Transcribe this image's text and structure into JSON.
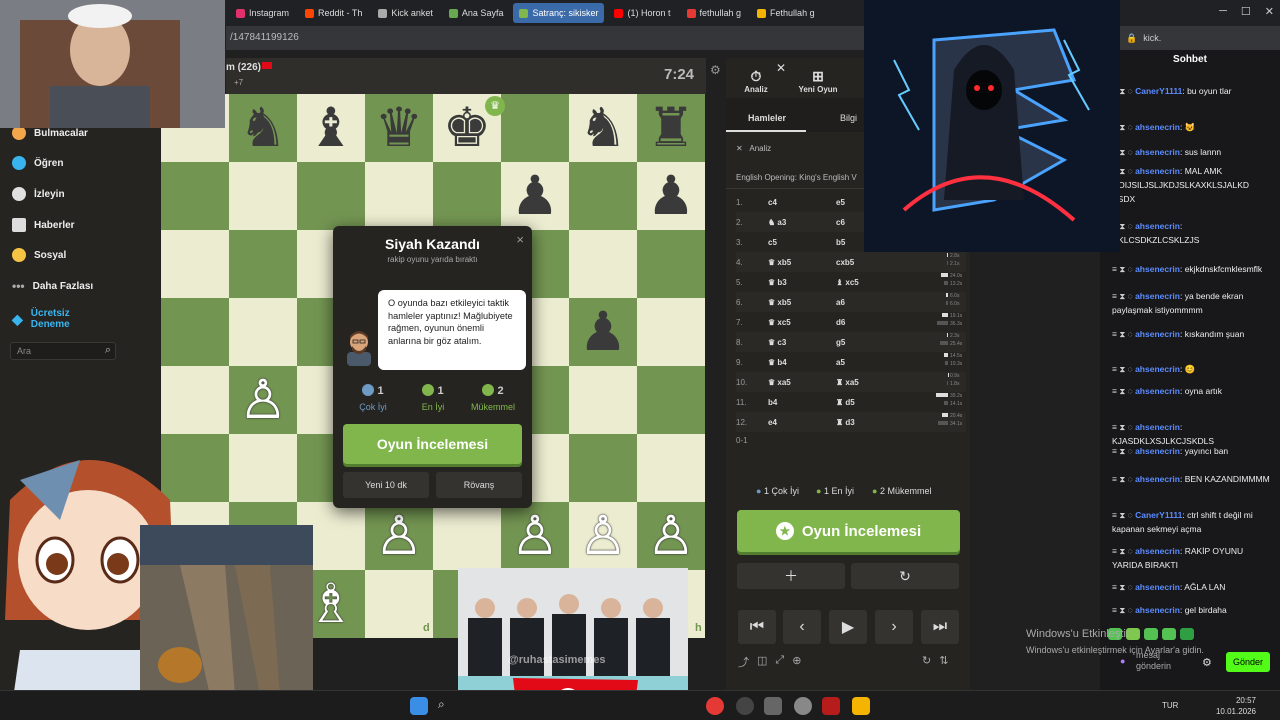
{
  "browser_tabs": [
    {
      "label": "Instagram",
      "color": "#e1306c"
    },
    {
      "label": "Reddit - Th",
      "color": "#ff4500"
    },
    {
      "label": "Kick anket",
      "color": "#aaaaaa"
    },
    {
      "label": "Ana Sayfa",
      "color": "#6aa84f"
    },
    {
      "label": "Satranç: sikisker",
      "color": "#81b64c"
    },
    {
      "label": "(1) Horon t",
      "color": "#ff0000"
    },
    {
      "label": "fethullah g",
      "color": "#e53935"
    },
    {
      "label": "Fethullah g",
      "color": "#f4b400"
    }
  ],
  "address": {
    "url": "/147841199126",
    "right": "kick."
  },
  "sidebar": {
    "items": [
      "Bulmacalar",
      "Öğren",
      "İzleyin",
      "Haberler",
      "Sosyal",
      "Daha Fazlası",
      "Ücretsiz Deneme"
    ],
    "search_placeholder": "Ara"
  },
  "player": {
    "name": "m (226)",
    "rating_change": "+7",
    "timer": "7:24"
  },
  "board": {
    "ranks": [
      "7",
      "6",
      "5",
      "4",
      "3",
      "2"
    ],
    "files": [
      "c",
      "d",
      "h"
    ],
    "pieces": [
      {
        "sq": "a8",
        "p": "♞",
        "c": "b"
      },
      {
        "sq": "b8",
        "p": "♝",
        "c": "b"
      },
      {
        "sq": "c8",
        "p": "♛",
        "c": "b"
      },
      {
        "sq": "d8",
        "p": "♚",
        "c": "b"
      },
      {
        "sq": "f8",
        "p": "♞",
        "c": "b"
      },
      {
        "sq": "g8",
        "p": "♜",
        "c": "b"
      },
      {
        "sq": "e7",
        "p": "♟",
        "c": "b"
      },
      {
        "sq": "g7",
        "p": "♟",
        "c": "b"
      },
      {
        "sq": "f5",
        "p": "♟",
        "c": "b"
      },
      {
        "sq": "a4",
        "p": "♙",
        "c": "w"
      },
      {
        "sq": "c2",
        "p": "♙",
        "c": "w"
      },
      {
        "sq": "e2",
        "p": "♙",
        "c": "w"
      },
      {
        "sq": "f2",
        "p": "♙",
        "c": "w"
      },
      {
        "sq": "g2",
        "p": "♙",
        "c": "w"
      },
      {
        "sq": "b1",
        "p": "♗",
        "c": "w"
      }
    ]
  },
  "modal": {
    "title": "Siyah Kazandı",
    "subtitle": "rakip oyunu yarıda bıraktı",
    "coach_text": "O oyunda bazı etkileyici taktik hamleler yaptınız! Mağlubiyete rağmen, oyunun önemli anlarına bir göz atalım.",
    "stats": [
      {
        "n": "1",
        "label": "Çok İyi",
        "color": "#6d9bc3"
      },
      {
        "n": "1",
        "label": "En İyi",
        "color": "#81b64c"
      },
      {
        "n": "2",
        "label": "Mükemmel",
        "color": "#81b64c"
      }
    ],
    "review_button": "Oyun İncelemesi",
    "new_game": "Yeni 10 dk",
    "rematch": "Rövanş",
    "close": "×"
  },
  "analysis": {
    "tabs": [
      "Analiz",
      "Yeni Oyun"
    ],
    "subtabs": [
      "Hamleler",
      "Bilgi"
    ],
    "analysis_label": "Analiz",
    "opening": "English Opening: King's English V",
    "moves": [
      {
        "n": "1.",
        "w": "c4",
        "b": "e5",
        "t1": "",
        "t2": ""
      },
      {
        "n": "2.",
        "w": "♞ a3",
        "b": "c6",
        "t1": "",
        "t2": ""
      },
      {
        "n": "3.",
        "w": "c5",
        "b": "b5",
        "t1": "",
        "t2": ""
      },
      {
        "n": "4.",
        "w": "♛ xb5",
        "b": "cxb5",
        "t1": "2.8s",
        "t2": "2.1s"
      },
      {
        "n": "5.",
        "w": "♛ b3",
        "b": "♝ xc5",
        "t1": "24.0s",
        "t2": "13.2s"
      },
      {
        "n": "6.",
        "w": "♛ xb5",
        "b": "a6",
        "t1": "6.0s",
        "t2": "6.0s"
      },
      {
        "n": "7.",
        "w": "♛ xc5",
        "b": "d6",
        "t1": "19.1s",
        "t2": "36.3s"
      },
      {
        "n": "8.",
        "w": "♛ c3",
        "b": "g5",
        "t1": "2.3s",
        "t2": "25.4s"
      },
      {
        "n": "9.",
        "w": "♛ b4",
        "b": "a5",
        "t1": "14.5s",
        "t2": "10.3s"
      },
      {
        "n": "10.",
        "w": "♛ xa5",
        "b": "♜ xa5",
        "t1": "0.9s",
        "t2": "1.8s"
      },
      {
        "n": "11.",
        "w": "b4",
        "b": "♜ d5",
        "t1": "39.2s",
        "t2": "14.1s"
      },
      {
        "n": "12.",
        "w": "e4",
        "b": "♜ d3",
        "t1": "20.4s",
        "t2": "34.1s"
      }
    ],
    "result": "0-1",
    "summary": [
      "1 Çok İyi",
      "1 En İyi",
      "2 Mükemmel"
    ],
    "review_button": "Oyun İncelemesi"
  },
  "chat": {
    "title": "Sohbet",
    "messages": [
      {
        "user": "CanerY1111",
        "ucolor": "#5b8cff",
        "text": ": bu oyun tlar"
      },
      {
        "user": "ahsenecrin",
        "ucolor": "#5b8cff",
        "text": ": 😺"
      },
      {
        "user": "ahsenecrin",
        "ucolor": "#5b8cff",
        "text": ": sus lannn"
      },
      {
        "user": "ahsenecrin",
        "ucolor": "#5b8cff",
        "text": ": MAL AMK DOIJSILJSLJKDJSLKAXKLSJALKD ASDX"
      },
      {
        "user": "ahsenecrin",
        "ucolor": "#5b8cff",
        "text": ": DKLCSDKZLCSKLZJS"
      },
      {
        "user": "ahsenecrin",
        "ucolor": "#5b8cff",
        "text": ": ekjkdnskfcmklesmflk"
      },
      {
        "user": "ahsenecrin",
        "ucolor": "#5b8cff",
        "text": ": ya bende ekran paylaşmak istiyommmm"
      },
      {
        "user": "ahsenecrin",
        "ucolor": "#5b8cff",
        "text": ": kıskandım şuan"
      },
      {
        "user": "ahsenecrin",
        "ucolor": "#5b8cff",
        "text": ": 😊"
      },
      {
        "user": "ahsenecrin",
        "ucolor": "#5b8cff",
        "text": ": oyna artık"
      },
      {
        "user": "ahsenecrin",
        "ucolor": "#5b8cff",
        "text": ": KJASDKLXSJLKCJSKDLS"
      },
      {
        "user": "ahsenecrin",
        "ucolor": "#5b8cff",
        "text": ": yayıncı ban"
      },
      {
        "user": "ahsenecrin",
        "ucolor": "#5b8cff",
        "text": ": BEN KAZANDIMMMM"
      },
      {
        "user": "CanerY1111",
        "ucolor": "#5b8cff",
        "text": ": ctrl shift t değil mi kapanan sekmeyi açma"
      },
      {
        "user": "ahsenecrin",
        "ucolor": "#5b8cff",
        "text": ": RAKİP OYUNU YARIDA BIRAKTI"
      },
      {
        "user": "ahsenecrin",
        "ucolor": "#5b8cff",
        "text": ": AĞLA LAN"
      },
      {
        "user": "ahsenecrin",
        "ucolor": "#5b8cff",
        "text": ": gel birdaha"
      }
    ],
    "input_placeholder": "mesaj gönderin",
    "send": "Gönder"
  },
  "windows_activation": {
    "line1": "Windows'u Etkinleştir",
    "line2": "Windows'u etkinleştirmek için Ayarlar'a gidin."
  },
  "overlay": {
    "watermark": "@ruhastasimemes"
  },
  "taskbar": {
    "lang": "TUR",
    "time": "20:57",
    "date": "10.01.2026"
  }
}
